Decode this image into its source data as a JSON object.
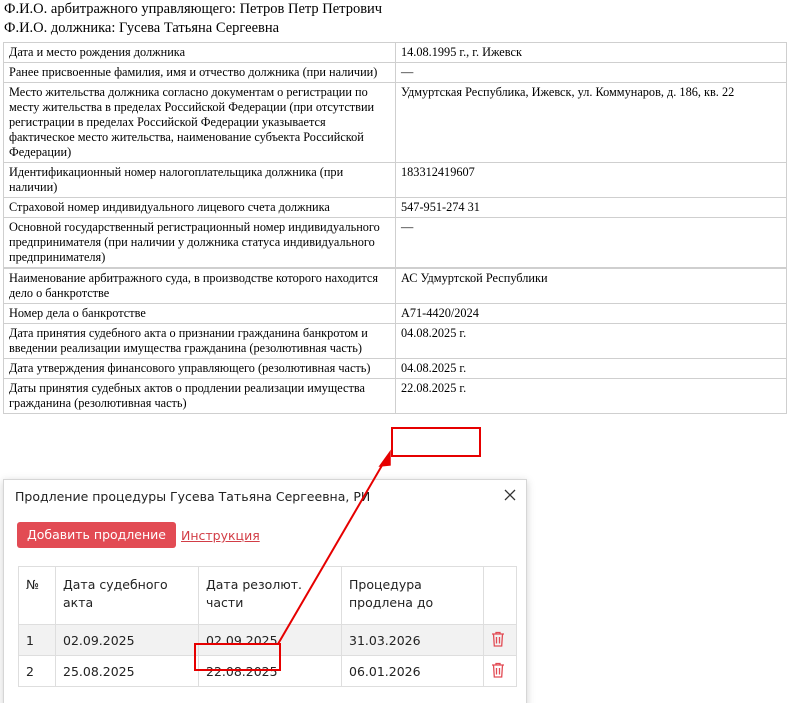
{
  "header": {
    "manager_line": "Ф.И.О. арбитражного управляющего: Петров Петр Петрович",
    "debtor_line": "Ф.И.О. должника: Гусева Татьяна Сергеевна"
  },
  "info_rows": [
    {
      "label": "Дата и место рождения должника",
      "value": "14.08.1995 г., г. Ижевск"
    },
    {
      "label": "Ранее присвоенные фамилия, имя и отчество должника (при наличии)",
      "value": "—"
    },
    {
      "label": "Место жительства должника согласно документам о регистрации по месту жительства в пределах Российской Федерации (при отсутствии регистрации в пределах Российской Федерации указывается фактическое место жительства, наименование субъекта Российской Федерации)",
      "value": "Удмуртская Республика, Ижевск, ул. Коммунаров, д. 186, кв. 22"
    },
    {
      "label": "Идентификационный номер налогоплательщика должника (при наличии)",
      "value": "183312419607"
    },
    {
      "label": "Страховой номер индивидуального лицевого счета должника",
      "value": "547-951-274 31"
    },
    {
      "label": "Основной государственный регистрационный номер индивидуального предпринимателя (при наличии у должника статуса индивидуального предпринимателя)",
      "value": "—"
    },
    {
      "label": "Наименование арбитражного суда, в производстве которого находится дело о банкротстве",
      "value": "АС Удмуртской Республики"
    },
    {
      "label": "Номер дела о банкротстве",
      "value": "А71-4420/2024"
    },
    {
      "label": "Дата принятия судебного акта о признании гражданина банкротом и введении реализации имущества гражданина (резолютивная часть)",
      "value": "04.08.2025 г."
    },
    {
      "label": "Дата утверждения финансового управляющего (резолютивная часть)",
      "value": "04.08.2025 г."
    },
    {
      "label": "Даты принятия судебных актов о продлении реализации имущества гражданина (резолютивная часть)",
      "value": "22.08.2025 г."
    }
  ],
  "dialog": {
    "title": "Продление процедуры Гусева Татьяна Сергеевна, РИ",
    "add_button": "Добавить продление",
    "instruction_link": "Инструкция",
    "columns": [
      "№",
      "Дата судебного акта",
      "Дата резолют. части",
      "Процедура продлена до"
    ],
    "rows": [
      {
        "num": "1",
        "act_date": "02.09.2025",
        "res_date": "02.09.2025",
        "extended_to": "31.03.2026"
      },
      {
        "num": "2",
        "act_date": "25.08.2025",
        "res_date": "22.08.2025",
        "extended_to": "06.01.2026"
      }
    ]
  },
  "icons": {
    "close": "close-icon",
    "delete": "trash-icon"
  },
  "colors": {
    "accent": "#e24b54",
    "highlight": "#e60000",
    "link": "#d23d46"
  }
}
